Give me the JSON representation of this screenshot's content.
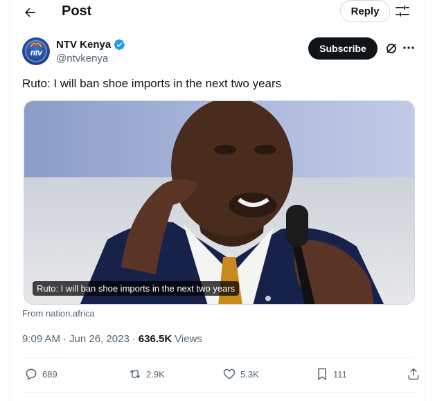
{
  "header": {
    "title": "Post",
    "reply_label": "Reply"
  },
  "author": {
    "name": "NTV Kenya",
    "handle": "@ntvkenya",
    "avatar_text": "ntv",
    "verified": true
  },
  "subscribe_label": "Subscribe",
  "tweet": {
    "text": "Ruto: I will ban shoe imports in the next two years",
    "media_caption": "Ruto: I will ban shoe imports in the next two years",
    "source": "From nation.africa",
    "time": "9:09 AM",
    "date": "Jun 26, 2023",
    "views_count": "636.5K",
    "views_label": "Views"
  },
  "stats": {
    "replies": "689",
    "reposts": "2.9K",
    "likes": "5.3K",
    "bookmarks": "111"
  },
  "colors": {
    "text": "#0f1419",
    "secondary": "#536471",
    "verified": "#1d9bf0",
    "border": "#eff3f4"
  },
  "icons": [
    "back-arrow-icon",
    "filter-sliders-icon",
    "verified-badge-icon",
    "grok-icon",
    "more-icon",
    "reply-icon",
    "repost-icon",
    "like-icon",
    "bookmark-icon",
    "share-icon"
  ]
}
